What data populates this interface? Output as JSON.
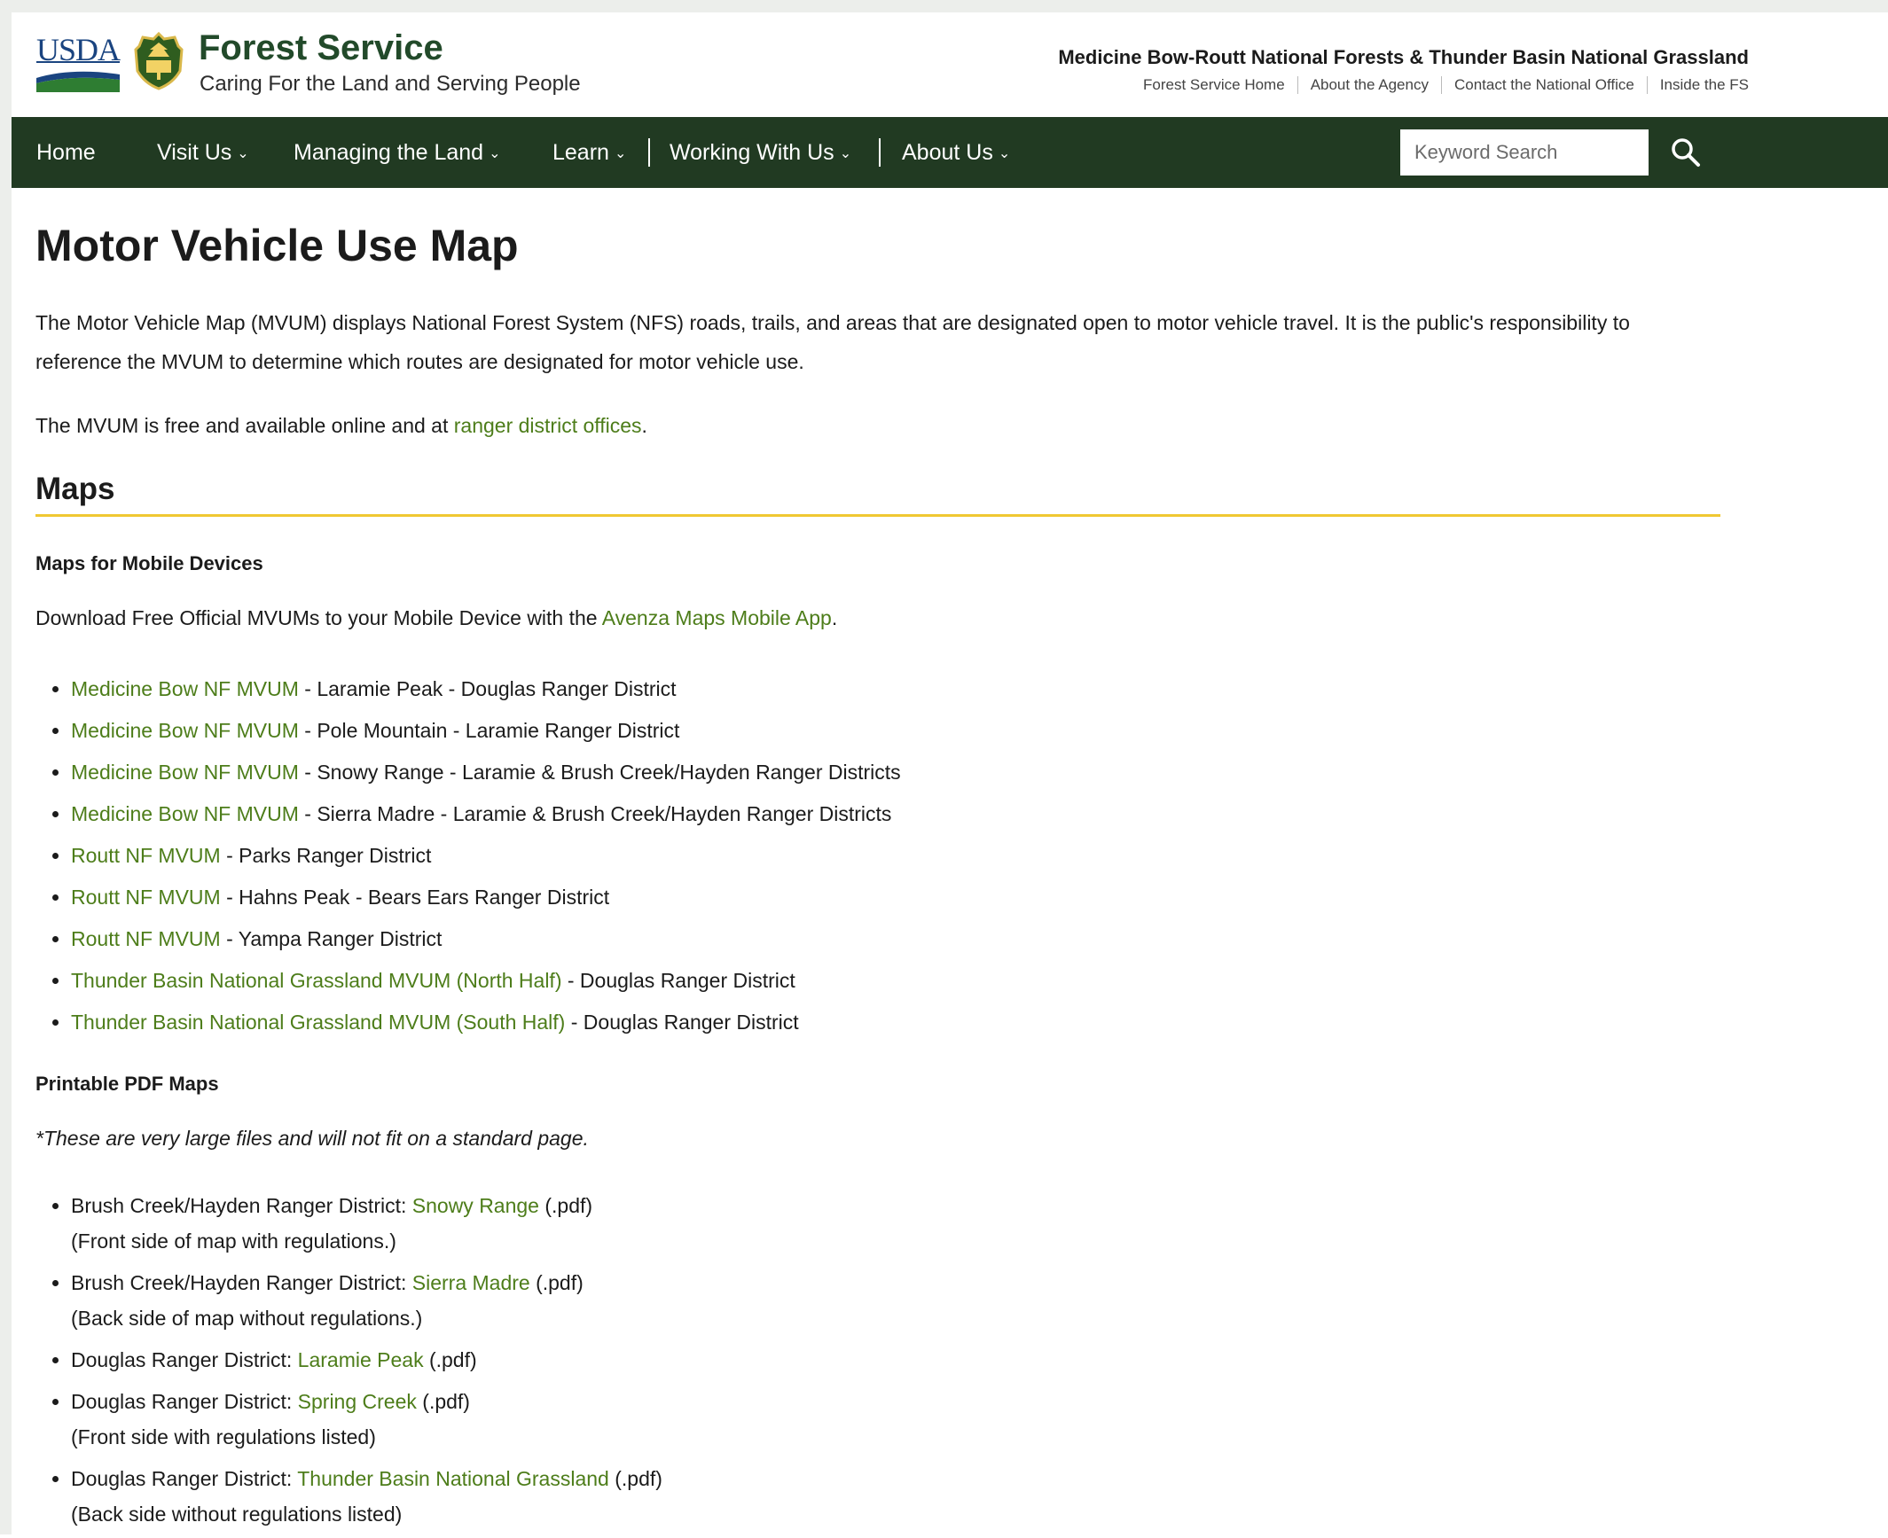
{
  "header": {
    "usda_logo": "USDA",
    "agency_name": "Forest Service",
    "tagline": "Caring For the Land and Serving People",
    "unit_name": "Medicine Bow-Routt National Forests & Thunder Basin National Grassland",
    "utility_links": [
      "Forest Service Home",
      "About the Agency",
      "Contact the National Office",
      "Inside the FS"
    ]
  },
  "nav": {
    "items": [
      "Home",
      "Visit Us",
      "Managing the Land",
      "Learn",
      "Working With Us",
      "About Us"
    ],
    "search_placeholder": "Keyword Search"
  },
  "page": {
    "title": "Motor Vehicle Use Map",
    "intro": "The Motor Vehicle Map (MVUM) displays National Forest System (NFS) roads, trails, and areas that are designated open to motor vehicle travel. It is the public's responsibility to reference the MVUM to determine which routes are designated for motor vehicle use.",
    "free_prefix": "The MVUM is free and available online and at ",
    "free_link": "ranger district offices",
    "free_suffix": "."
  },
  "maps_section": {
    "heading": "Maps",
    "mobile_heading": "Maps for Mobile Devices",
    "mobile_prefix": "Download Free Official MVUMs to your Mobile Device with the ",
    "mobile_link": "Avenza Maps Mobile App",
    "mobile_suffix": ".",
    "mobile_items": [
      {
        "link": "Medicine Bow NF MVUM",
        "text": " - Laramie Peak - Douglas Ranger District"
      },
      {
        "link": "Medicine Bow NF MVUM ",
        "text": "- Pole Mountain - Laramie Ranger District"
      },
      {
        "link": "Medicine Bow NF MVUM",
        "text": " - Snowy Range - Laramie & Brush Creek/Hayden Ranger Districts"
      },
      {
        "link": "Medicine Bow NF MVUM ",
        "text": "- Sierra Madre - Laramie & Brush Creek/Hayden Ranger Districts"
      },
      {
        "link": "Routt NF MVUM ",
        "text": "- Parks Ranger District"
      },
      {
        "link": "Routt NF MVUM",
        "text": " - Hahns Peak - Bears Ears Ranger District"
      },
      {
        "link": "Routt NF MVUM",
        "text": " - Yampa Ranger District"
      },
      {
        "link": "Thunder Basin National Grassland MVUM (North Half)",
        "text": " - Douglas Ranger District"
      },
      {
        "link": "Thunder Basin National Grassland MVUM (South Half)",
        "text": " - Douglas Ranger District"
      }
    ],
    "pdf_heading": "Printable PDF Maps",
    "pdf_note": "*These are very large files and will not fit on a standard page.",
    "pdf_items": [
      {
        "prefix": "Brush Creek/Hayden Ranger District: ",
        "link": "Snowy Range",
        "suffix": " (.pdf)",
        "note": "(Front side of map with regulations.)"
      },
      {
        "prefix": "Brush Creek/Hayden Ranger District: ",
        "link": "Sierra Madre",
        "suffix": " (.pdf)",
        "note": "(Back side of map without regulations.)"
      },
      {
        "prefix": "Douglas Ranger District: ",
        "link": "Laramie Peak",
        "suffix": " (.pdf)",
        "note": ""
      },
      {
        "prefix": "Douglas Ranger District: ",
        "link": "Spring Creek",
        "suffix": " (.pdf)",
        "note": "(Front side with regulations listed)"
      },
      {
        "prefix": "Douglas Ranger District: ",
        "link": "Thunder Basin National Grassland",
        "suffix": " (.pdf)",
        "note": "(Back side without regulations listed)"
      }
    ]
  },
  "colors": {
    "nav_bg": "#213a22",
    "link": "#4d7d1a",
    "heading_rule": "#f0c832",
    "usda_blue": "#1a4480"
  }
}
